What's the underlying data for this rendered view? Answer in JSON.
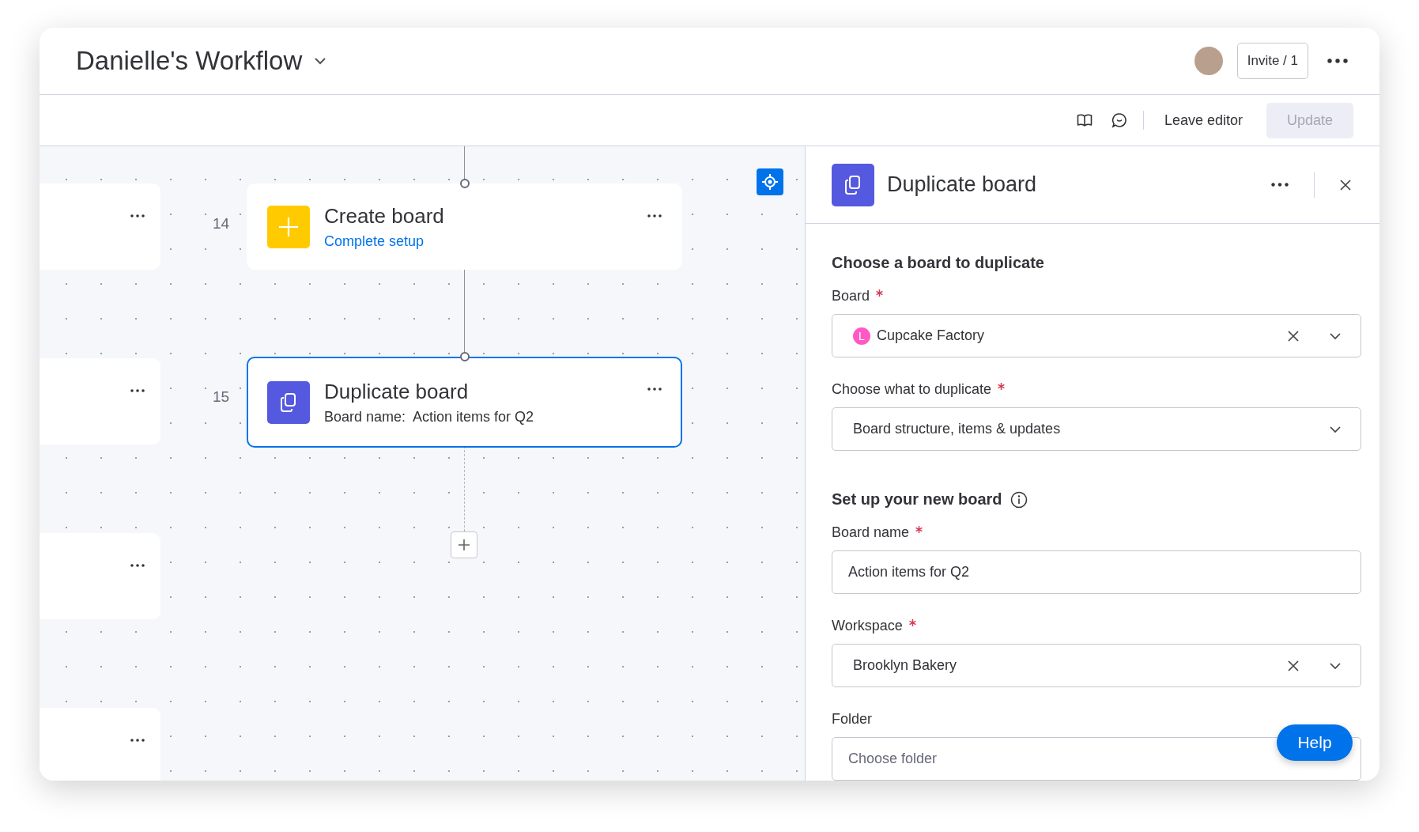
{
  "window": {
    "title": "Danielle's Workflow"
  },
  "header": {
    "invite_button": "Invite / 1"
  },
  "toolbar": {
    "leave_editor": "Leave editor",
    "update_button": {
      "label": "Update",
      "disabled": true
    }
  },
  "canvas": {
    "steps": [
      {
        "number": "14",
        "kind": "create",
        "title": "Create board",
        "subtitle": "Complete setup",
        "selected": false
      },
      {
        "number": "15",
        "kind": "duplicate",
        "title": "Duplicate board",
        "subtitle": "Board name:  Action items for Q2",
        "selected": true
      }
    ]
  },
  "panel": {
    "title": "Duplicate board",
    "sections": [
      {
        "heading": "Choose a board to duplicate",
        "info": false,
        "fields": [
          {
            "label": "Board",
            "required": true,
            "kind": "select",
            "value": "Cupcake Factory",
            "clearable": true,
            "badge": "L",
            "color": "#ff5ac4"
          },
          {
            "label": "Choose what to duplicate",
            "required": true,
            "kind": "select",
            "value": "Board structure, items & updates",
            "clearable": false
          }
        ]
      },
      {
        "heading": "Set up your new board",
        "info": true,
        "fields": [
          {
            "label": "Board name",
            "required": true,
            "kind": "text",
            "value": "Action items for Q2"
          },
          {
            "label": "Workspace",
            "required": true,
            "kind": "select",
            "value": "Brooklyn Bakery",
            "clearable": true
          },
          {
            "label": "Folder",
            "required": false,
            "kind": "text",
            "placeholder": "Choose folder"
          }
        ]
      }
    ]
  },
  "help_button": "Help"
}
